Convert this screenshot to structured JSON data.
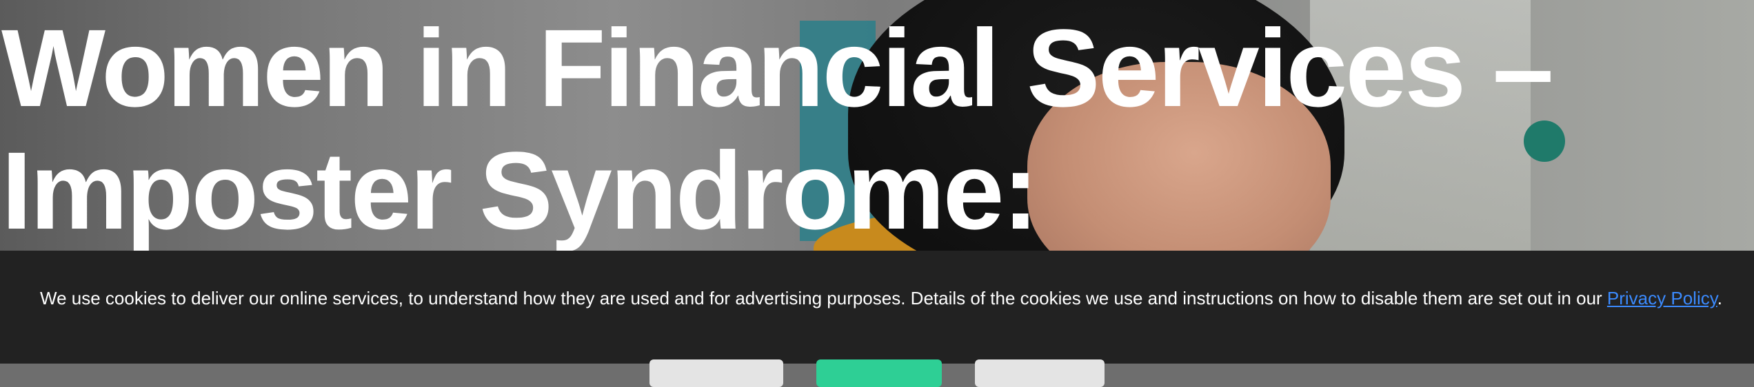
{
  "hero": {
    "title_line1": "Women in Financial Services –",
    "title_line2": "Imposter Syndrome:"
  },
  "cookie_banner": {
    "message": "We use cookies to deliver our online services, to understand how they are used and for advertising purposes. Details of the cookies we use and instructions on how to disable them are set out in our ",
    "privacy_link": "Privacy Policy",
    "trailing": ".",
    "colors": {
      "background": "#222222",
      "link": "#3b8bff",
      "accept_button": "#2ecf95",
      "secondary_button": "#e4e4e4"
    }
  }
}
